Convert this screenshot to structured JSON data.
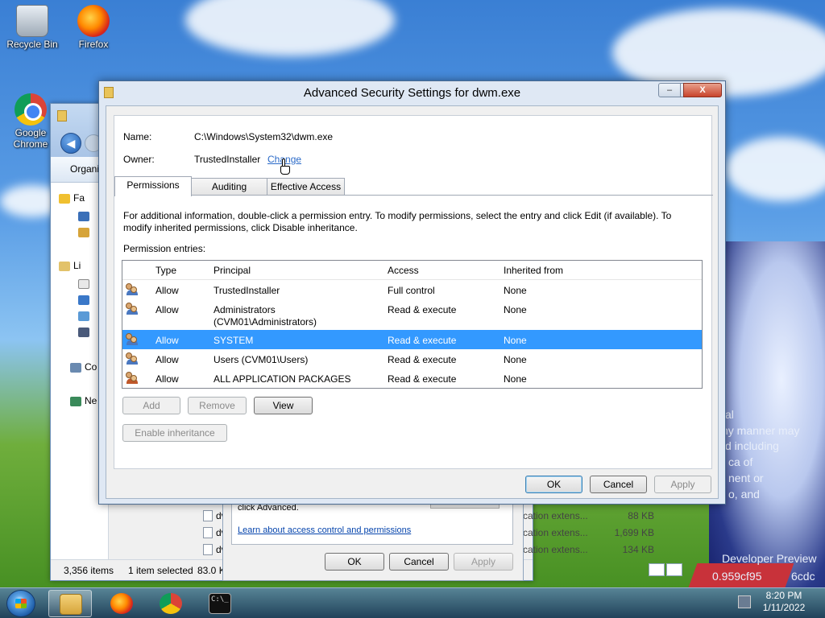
{
  "desktop": {
    "icons": [
      {
        "label": "Recycle Bin"
      },
      {
        "label": "Firefox"
      },
      {
        "label": "Google Chrome"
      }
    ],
    "watermark_lines": [
      "al",
      "ny manner may",
      "d including",
      "ca of",
      "nent or",
      "o, and",
      "Developer Preview",
      "0.959cf95",
      "6cdc"
    ]
  },
  "explorer": {
    "toolbar_label": "Organi",
    "nav": [
      {
        "label": "Fa",
        "icon": "star-icon"
      },
      {
        "label": "",
        "icon": "desktop-icon"
      },
      {
        "label": "",
        "icon": "downloads-icon"
      },
      {
        "label": "Li",
        "icon": "libraries-icon"
      },
      {
        "label": "",
        "icon": "documents-icon"
      },
      {
        "label": "",
        "icon": "music-icon"
      },
      {
        "label": "",
        "icon": "pictures-icon"
      },
      {
        "label": "",
        "icon": "videos-icon"
      },
      {
        "label": "Co",
        "icon": "computer-icon"
      },
      {
        "label": "Ne",
        "icon": "network-icon"
      }
    ],
    "files": [
      {
        "name": "dv",
        "type": "cation extens...",
        "size": "88 KB"
      },
      {
        "name": "dv",
        "type": "cation extens...",
        "size": "1,699 KB"
      },
      {
        "name": "dv",
        "type": "cation extens...",
        "size": "134 KB"
      }
    ],
    "status": {
      "items": "3,356 items",
      "selected": "1 item selected",
      "size": "83.0 K"
    }
  },
  "properties_dialog": {
    "text": "click Advanced.",
    "link": "Learn about access control and permissions",
    "ok": "OK",
    "cancel": "Cancel",
    "apply": "Apply"
  },
  "dialog": {
    "title": "Advanced Security Settings for dwm.exe",
    "name_label": "Name:",
    "name_value": "C:\\Windows\\System32\\dwm.exe",
    "owner_label": "Owner:",
    "owner_value": "TrustedInstaller",
    "change_link": "Change",
    "tabs": [
      {
        "label": "Permissions",
        "active": true
      },
      {
        "label": "Auditing",
        "active": false
      },
      {
        "label": "Effective Access",
        "active": false
      }
    ],
    "info_line1": "For additional information, double-click a permission entry. To modify permissions, select the entry and click Edit (if available). To",
    "info_line2": "modify inherited permissions, click Disable inheritance.",
    "entries_label": "Permission entries:",
    "columns": {
      "type": "Type",
      "principal": "Principal",
      "access": "Access",
      "inherited": "Inherited from"
    },
    "entries": [
      {
        "type": "Allow",
        "principal": "TrustedInstaller",
        "principal2": "",
        "access": "Full control",
        "inherited": "None",
        "icon": "users-icon"
      },
      {
        "type": "Allow",
        "principal": "Administrators",
        "principal2": "(CVM01\\Administrators)",
        "access": "Read & execute",
        "inherited": "None",
        "icon": "users-icon"
      },
      {
        "type": "Allow",
        "principal": "SYSTEM",
        "principal2": "",
        "access": "Read & execute",
        "inherited": "None",
        "icon": "users-icon",
        "selected": true
      },
      {
        "type": "Allow",
        "principal": "Users (CVM01\\Users)",
        "principal2": "",
        "access": "Read & execute",
        "inherited": "None",
        "icon": "users-icon"
      },
      {
        "type": "Allow",
        "principal": "ALL APPLICATION PACKAGES",
        "principal2": "",
        "access": "Read & execute",
        "inherited": "None",
        "icon": "app-packages-icon"
      }
    ],
    "buttons": {
      "add": "Add",
      "remove": "Remove",
      "view": "View",
      "enable_inheritance": "Enable inheritance",
      "ok": "OK",
      "cancel": "Cancel",
      "apply": "Apply"
    },
    "caption": {
      "minimize": "–",
      "maximize": "□",
      "close": "X"
    }
  },
  "taskbar": {
    "time": "8:20 PM",
    "date": "1/11/2022",
    "cmd_text": "C:\\_"
  }
}
